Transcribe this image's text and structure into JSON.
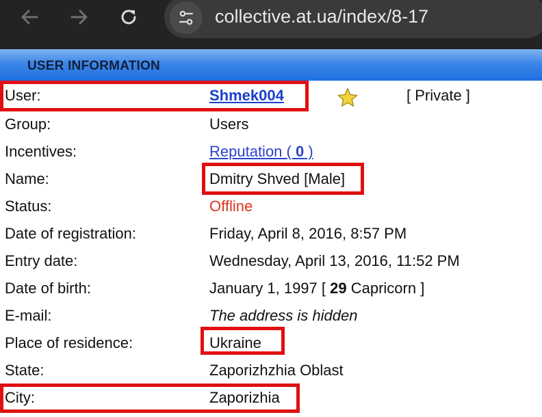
{
  "browser": {
    "url": "collective.at.ua/index/8-17"
  },
  "section": {
    "title": "USER INFORMATION"
  },
  "rows": {
    "user": {
      "label": "User:",
      "value": "Shmek004",
      "visibility": "[ Private ]"
    },
    "group": {
      "label": "Group:",
      "value": "Users"
    },
    "incentives": {
      "label": "Incentives:",
      "link_prefix": "Reputation ( ",
      "count": "0",
      "link_suffix": " )"
    },
    "name": {
      "label": "Name:",
      "value": "Dmitry Shved [Male]"
    },
    "status": {
      "label": "Status:",
      "value": "Offline"
    },
    "registration": {
      "label": "Date of registration:",
      "value": "Friday, April 8, 2016, 8:57 PM"
    },
    "entry": {
      "label": "Entry date:",
      "value": "Wednesday, April 13, 2016, 11:52 PM"
    },
    "birth": {
      "label": "Date of birth:",
      "prefix": "January 1, 1997 [ ",
      "age": "29",
      "suffix": " Capricorn ]"
    },
    "email": {
      "label": "E-mail:",
      "value": "The address is hidden"
    },
    "residence": {
      "label": "Place of residence:",
      "value": "Ukraine"
    },
    "state": {
      "label": "State:",
      "value": "Zaporizhzhia Oblast"
    },
    "city": {
      "label": "City:",
      "value": "Zaporizhia"
    }
  },
  "colors": {
    "link": "#1a3fcc",
    "offline": "#d9341e",
    "highlight": "#e01010",
    "header_gradient_top": "#7fb3f2",
    "header_gradient_bottom": "#1f6fe0"
  },
  "icons": {
    "back": "arrow-left-icon",
    "forward": "arrow-right-icon",
    "reload": "reload-icon",
    "site_info": "tune-icon",
    "rank": "star-icon"
  }
}
